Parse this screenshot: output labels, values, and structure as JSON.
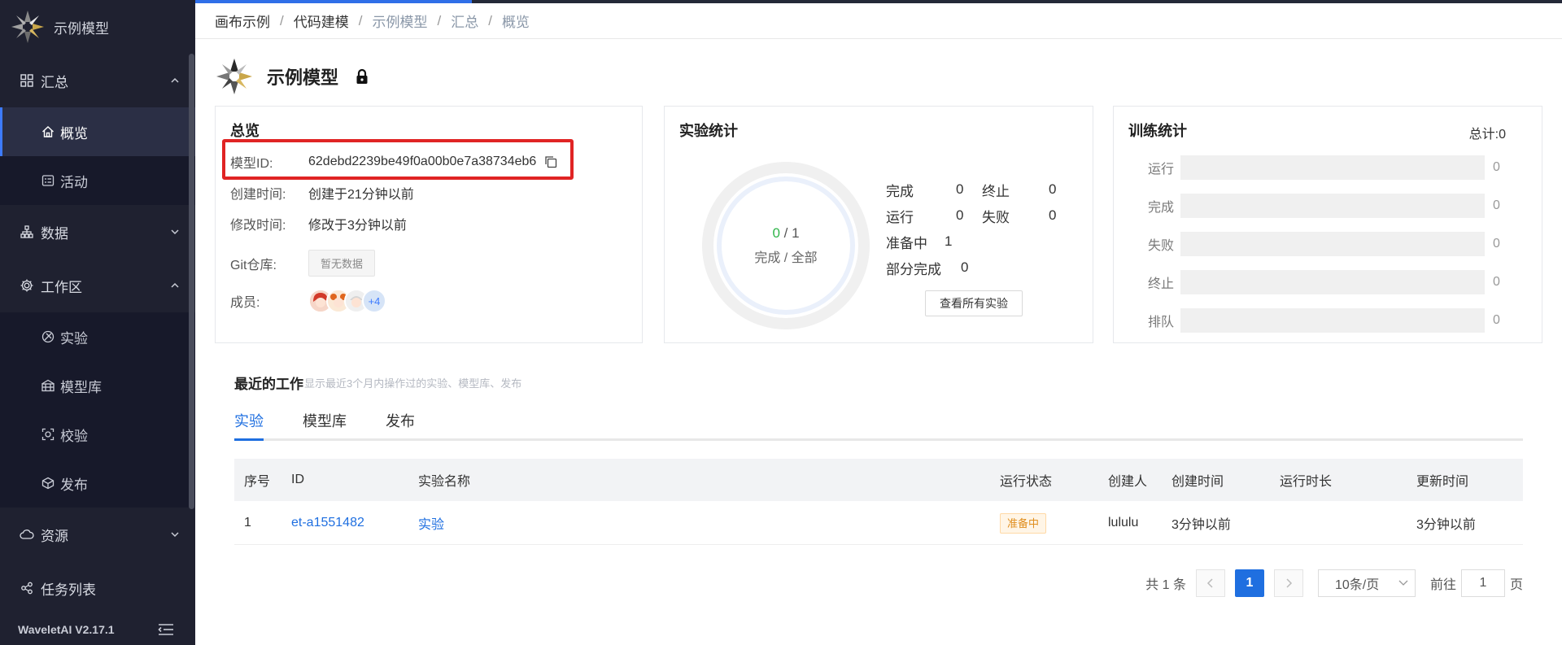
{
  "app": {
    "name": "示例模型",
    "version": "WaveletAI V2.17.1"
  },
  "sidebar": {
    "groups": [
      {
        "label": "汇总",
        "icon": "grid-icon",
        "expanded": true,
        "items": [
          {
            "label": "概览",
            "icon": "home-icon",
            "active": true
          },
          {
            "label": "活动",
            "icon": "activity-icon",
            "active": false
          }
        ]
      },
      {
        "label": "数据",
        "icon": "data-tree-icon",
        "expanded": false,
        "items": []
      },
      {
        "label": "工作区",
        "icon": "gear-icon",
        "expanded": true,
        "items": [
          {
            "label": "实验",
            "icon": "experiment-icon"
          },
          {
            "label": "模型库",
            "icon": "model-library-icon"
          },
          {
            "label": "校验",
            "icon": "scan-icon"
          },
          {
            "label": "发布",
            "icon": "cube-icon"
          }
        ]
      },
      {
        "label": "资源",
        "icon": "cloud-icon",
        "expanded": false,
        "items": []
      },
      {
        "label": "任务列表",
        "icon": "share-icon",
        "expanded": false,
        "items": []
      }
    ]
  },
  "breadcrumb": [
    "画布示例",
    "代码建模",
    "示例模型",
    "汇总",
    "概览"
  ],
  "page": {
    "title": "示例模型"
  },
  "overview": {
    "title": "总览",
    "rows": [
      {
        "key": "模型ID:",
        "value": "62debd2239be49f0a00b0e7a38734eb6"
      },
      {
        "key": "创建时间:",
        "value": "创建于21分钟以前"
      },
      {
        "key": "修改时间:",
        "value": "修改于3分钟以前"
      },
      {
        "key": "Git仓库:",
        "value": "暂无数据"
      },
      {
        "key": "成员:",
        "value": "+4"
      }
    ]
  },
  "experiment_stats": {
    "title": "实验统计",
    "done": "0",
    "total": "1",
    "center_label": "完成 / 全部",
    "items": [
      {
        "label": "完成",
        "value": "0"
      },
      {
        "label": "终止",
        "value": "0"
      },
      {
        "label": "运行",
        "value": "0"
      },
      {
        "label": "失败",
        "value": "0"
      },
      {
        "label": "准备中",
        "value": "1"
      },
      {
        "label": "部分完成",
        "value": "0"
      }
    ],
    "button_label": "查看所有实验"
  },
  "training_stats": {
    "title": "训练统计",
    "total_label": "总计:0",
    "bars": [
      {
        "label": "运行",
        "value": "0",
        "fraction": 0
      },
      {
        "label": "完成",
        "value": "0",
        "fraction": 0
      },
      {
        "label": "失败",
        "value": "0",
        "fraction": 0
      },
      {
        "label": "终止",
        "value": "0",
        "fraction": 0
      },
      {
        "label": "排队",
        "value": "0",
        "fraction": 0
      }
    ]
  },
  "recent": {
    "title": "最近的工作",
    "subtitle": "显示最近3个月内操作过的实验、模型库、发布",
    "tabs": [
      "实验",
      "模型库",
      "发布"
    ],
    "columns": [
      "序号",
      "ID",
      "实验名称",
      "运行状态",
      "创建人",
      "创建时间",
      "运行时长",
      "更新时间"
    ],
    "rows": [
      {
        "index": "1",
        "id": "et-a1551482",
        "name": "实验",
        "status": "准备中",
        "creator": "lululu",
        "created": "3分钟以前",
        "duration": "",
        "updated": "3分钟以前"
      }
    ],
    "pagination": {
      "total_text": "共 1 条",
      "current": "1",
      "page_size": "10条/页",
      "goto_label": "前往",
      "goto_value": "1",
      "page_unit": "页"
    }
  },
  "colors": {
    "accent": "#1f6fe0",
    "sidebar_bg": "#1f2130",
    "highlight_border": "#e02424",
    "done_green": "#2fb54a",
    "status_orange": "#e08e1e"
  }
}
